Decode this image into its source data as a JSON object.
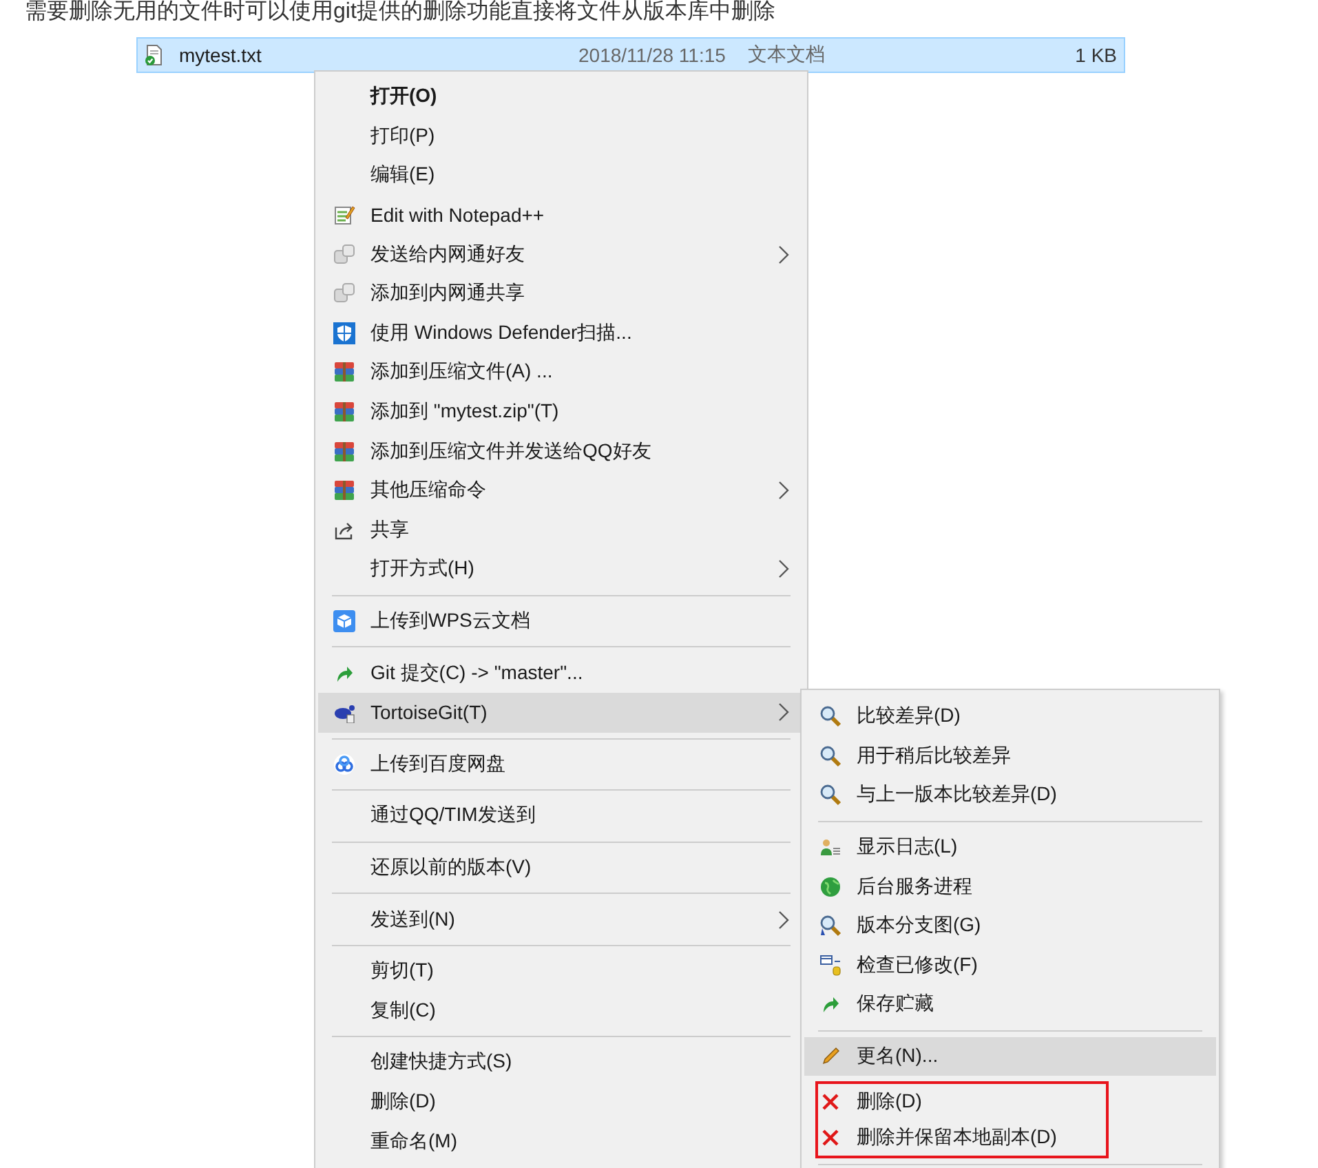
{
  "intro_text": "需要删除无用的文件时可以使用git提供的删除功能直接将文件从版本库中删除",
  "file": {
    "name": "mytest.txt",
    "modified": "2018/11/28 11:15",
    "type": "文本文档",
    "size": "1 KB",
    "selected": true
  },
  "context_menu": {
    "items": [
      {
        "kind": "item",
        "label": "打开(O)",
        "default": true,
        "submenu": false,
        "selected": false
      },
      {
        "kind": "item",
        "label": "打印(P)",
        "default": false,
        "submenu": false,
        "selected": false
      },
      {
        "kind": "item",
        "label": "编辑(E)",
        "default": false,
        "submenu": false,
        "selected": false
      },
      {
        "kind": "item",
        "label": "Edit with Notepad++",
        "default": false,
        "submenu": false,
        "selected": false
      },
      {
        "kind": "item",
        "label": "发送给内网通好友",
        "default": false,
        "submenu": true,
        "selected": false
      },
      {
        "kind": "item",
        "label": "添加到内网通共享",
        "default": false,
        "submenu": false,
        "selected": false
      },
      {
        "kind": "item",
        "label": "使用 Windows Defender扫描...",
        "default": false,
        "submenu": false,
        "selected": false
      },
      {
        "kind": "item",
        "label": "添加到压缩文件(A) ...",
        "default": false,
        "submenu": false,
        "selected": false
      },
      {
        "kind": "item",
        "label": "添加到 \"mytest.zip\"(T)",
        "default": false,
        "submenu": false,
        "selected": false
      },
      {
        "kind": "item",
        "label": "添加到压缩文件并发送给QQ好友",
        "default": false,
        "submenu": false,
        "selected": false
      },
      {
        "kind": "item",
        "label": "其他压缩命令",
        "default": false,
        "submenu": true,
        "selected": false
      },
      {
        "kind": "item",
        "label": "共享",
        "default": false,
        "submenu": false,
        "selected": false
      },
      {
        "kind": "item",
        "label": "打开方式(H)",
        "default": false,
        "submenu": true,
        "selected": false
      },
      {
        "kind": "separator"
      },
      {
        "kind": "item",
        "label": "上传到WPS云文档",
        "default": false,
        "submenu": false,
        "selected": false
      },
      {
        "kind": "separator"
      },
      {
        "kind": "item",
        "label": "Git 提交(C) -> \"master\"...",
        "default": false,
        "submenu": false,
        "selected": false
      },
      {
        "kind": "item",
        "label": "TortoiseGit(T)",
        "default": false,
        "submenu": true,
        "selected": true
      },
      {
        "kind": "separator"
      },
      {
        "kind": "item",
        "label": "上传到百度网盘",
        "default": false,
        "submenu": false,
        "selected": false
      },
      {
        "kind": "separator"
      },
      {
        "kind": "item",
        "label": "通过QQ/TIM发送到",
        "default": false,
        "submenu": false,
        "selected": false
      },
      {
        "kind": "separator"
      },
      {
        "kind": "item",
        "label": "还原以前的版本(V)",
        "default": false,
        "submenu": false,
        "selected": false
      },
      {
        "kind": "separator"
      },
      {
        "kind": "item",
        "label": "发送到(N)",
        "default": false,
        "submenu": true,
        "selected": false
      },
      {
        "kind": "separator"
      },
      {
        "kind": "item",
        "label": "剪切(T)",
        "default": false,
        "submenu": false,
        "selected": false
      },
      {
        "kind": "item",
        "label": "复制(C)",
        "default": false,
        "submenu": false,
        "selected": false
      },
      {
        "kind": "separator"
      },
      {
        "kind": "item",
        "label": "创建快捷方式(S)",
        "default": false,
        "submenu": false,
        "selected": false
      },
      {
        "kind": "item",
        "label": "删除(D)",
        "default": false,
        "submenu": false,
        "selected": false
      },
      {
        "kind": "item",
        "label": "重命名(M)",
        "default": false,
        "submenu": false,
        "selected": false
      }
    ]
  },
  "submenu": {
    "items": [
      {
        "kind": "item",
        "label": "比较差异(D)",
        "selected": false
      },
      {
        "kind": "item",
        "label": "用于稍后比较差异",
        "selected": false
      },
      {
        "kind": "item",
        "label": "与上一版本比较差异(D)",
        "selected": false
      },
      {
        "kind": "separator"
      },
      {
        "kind": "item",
        "label": "显示日志(L)",
        "selected": false
      },
      {
        "kind": "item",
        "label": "后台服务进程",
        "selected": false
      },
      {
        "kind": "item",
        "label": "版本分支图(G)",
        "selected": false
      },
      {
        "kind": "item",
        "label": "检查已修改(F)",
        "selected": false
      },
      {
        "kind": "item",
        "label": "保存贮藏",
        "selected": false
      },
      {
        "kind": "separator"
      },
      {
        "kind": "item",
        "label": "更名(N)...",
        "selected": true
      },
      {
        "kind": "group",
        "marked": true,
        "items": [
          {
            "kind": "item",
            "label": "删除(D)",
            "selected": false
          },
          {
            "kind": "item",
            "label": "删除并保留本地副本(D)",
            "selected": false
          }
        ]
      },
      {
        "kind": "separator"
      }
    ]
  }
}
